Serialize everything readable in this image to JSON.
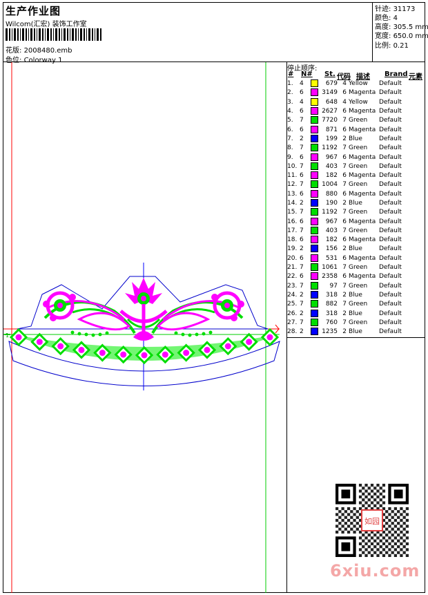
{
  "header": {
    "title": "生产作业图",
    "company": "Wilcom(汇宏) 装饰工作室",
    "design_label": "花版:",
    "design_value": "2008480.emb",
    "colorway_label": "色位:",
    "colorway_value": "Colorway 1"
  },
  "stats": [
    {
      "label": "针迹:",
      "value": "31173"
    },
    {
      "label": "颜色:",
      "value": "4"
    },
    {
      "label": "高度:",
      "value": "305.5 mm"
    },
    {
      "label": "宽度:",
      "value": "650.0 mm"
    },
    {
      "label": "比例:",
      "value": "0.21"
    }
  ],
  "stop_sequence": {
    "title": "停止顺序:",
    "headers": [
      "#",
      "N#",
      "St.",
      "代码",
      "描述",
      "Brand",
      "元素"
    ],
    "rows": [
      {
        "idx": "1.",
        "n": "4",
        "color": "#ffff00",
        "st": "679",
        "code": "4",
        "desc": "Yellow",
        "brand": "Default"
      },
      {
        "idx": "2.",
        "n": "6",
        "color": "#ff00ff",
        "st": "3149",
        "code": "6",
        "desc": "Magenta",
        "brand": "Default"
      },
      {
        "idx": "3.",
        "n": "4",
        "color": "#ffff00",
        "st": "648",
        "code": "4",
        "desc": "Yellow",
        "brand": "Default"
      },
      {
        "idx": "4.",
        "n": "6",
        "color": "#ff00ff",
        "st": "2627",
        "code": "6",
        "desc": "Magenta",
        "brand": "Default"
      },
      {
        "idx": "5.",
        "n": "7",
        "color": "#00dd00",
        "st": "7720",
        "code": "7",
        "desc": "Green",
        "brand": "Default"
      },
      {
        "idx": "6.",
        "n": "6",
        "color": "#ff00ff",
        "st": "871",
        "code": "6",
        "desc": "Magenta",
        "brand": "Default"
      },
      {
        "idx": "7.",
        "n": "2",
        "color": "#0000ff",
        "st": "199",
        "code": "2",
        "desc": "Blue",
        "brand": "Default"
      },
      {
        "idx": "8.",
        "n": "7",
        "color": "#00dd00",
        "st": "1192",
        "code": "7",
        "desc": "Green",
        "brand": "Default"
      },
      {
        "idx": "9.",
        "n": "6",
        "color": "#ff00ff",
        "st": "967",
        "code": "6",
        "desc": "Magenta",
        "brand": "Default"
      },
      {
        "idx": "10.",
        "n": "7",
        "color": "#00dd00",
        "st": "403",
        "code": "7",
        "desc": "Green",
        "brand": "Default"
      },
      {
        "idx": "11.",
        "n": "6",
        "color": "#ff00ff",
        "st": "182",
        "code": "6",
        "desc": "Magenta",
        "brand": "Default"
      },
      {
        "idx": "12.",
        "n": "7",
        "color": "#00dd00",
        "st": "1004",
        "code": "7",
        "desc": "Green",
        "brand": "Default"
      },
      {
        "idx": "13.",
        "n": "6",
        "color": "#ff00ff",
        "st": "880",
        "code": "6",
        "desc": "Magenta",
        "brand": "Default"
      },
      {
        "idx": "14.",
        "n": "2",
        "color": "#0000ff",
        "st": "190",
        "code": "2",
        "desc": "Blue",
        "brand": "Default"
      },
      {
        "idx": "15.",
        "n": "7",
        "color": "#00dd00",
        "st": "1192",
        "code": "7",
        "desc": "Green",
        "brand": "Default"
      },
      {
        "idx": "16.",
        "n": "6",
        "color": "#ff00ff",
        "st": "967",
        "code": "6",
        "desc": "Magenta",
        "brand": "Default"
      },
      {
        "idx": "17.",
        "n": "7",
        "color": "#00dd00",
        "st": "403",
        "code": "7",
        "desc": "Green",
        "brand": "Default"
      },
      {
        "idx": "18.",
        "n": "6",
        "color": "#ff00ff",
        "st": "182",
        "code": "6",
        "desc": "Magenta",
        "brand": "Default"
      },
      {
        "idx": "19.",
        "n": "2",
        "color": "#0000ff",
        "st": "156",
        "code": "2",
        "desc": "Blue",
        "brand": "Default"
      },
      {
        "idx": "20.",
        "n": "6",
        "color": "#ff00ff",
        "st": "531",
        "code": "6",
        "desc": "Magenta",
        "brand": "Default"
      },
      {
        "idx": "21.",
        "n": "7",
        "color": "#00dd00",
        "st": "1061",
        "code": "7",
        "desc": "Green",
        "brand": "Default"
      },
      {
        "idx": "22.",
        "n": "6",
        "color": "#ff00ff",
        "st": "2358",
        "code": "6",
        "desc": "Magenta",
        "brand": "Default"
      },
      {
        "idx": "23.",
        "n": "7",
        "color": "#00dd00",
        "st": "97",
        "code": "7",
        "desc": "Green",
        "brand": "Default"
      },
      {
        "idx": "24.",
        "n": "2",
        "color": "#0000ff",
        "st": "318",
        "code": "2",
        "desc": "Blue",
        "brand": "Default"
      },
      {
        "idx": "25.",
        "n": "7",
        "color": "#00dd00",
        "st": "882",
        "code": "7",
        "desc": "Green",
        "brand": "Default"
      },
      {
        "idx": "26.",
        "n": "2",
        "color": "#0000ff",
        "st": "318",
        "code": "2",
        "desc": "Blue",
        "brand": "Default"
      },
      {
        "idx": "27.",
        "n": "7",
        "color": "#00dd00",
        "st": "760",
        "code": "7",
        "desc": "Green",
        "brand": "Default"
      },
      {
        "idx": "28.",
        "n": "2",
        "color": "#0000ff",
        "st": "1235",
        "code": "2",
        "desc": "Blue",
        "brand": "Default"
      }
    ]
  },
  "watermark": {
    "site": "6xiu.com",
    "seal": "如园"
  },
  "colors": {
    "yellow": "#ffff00",
    "magenta": "#ff00ff",
    "green": "#00dd00",
    "blue": "#0000ff",
    "guide_red": "#ff0000",
    "guide_green": "#00cc00",
    "watermark_pink": "#f4a7a7"
  }
}
